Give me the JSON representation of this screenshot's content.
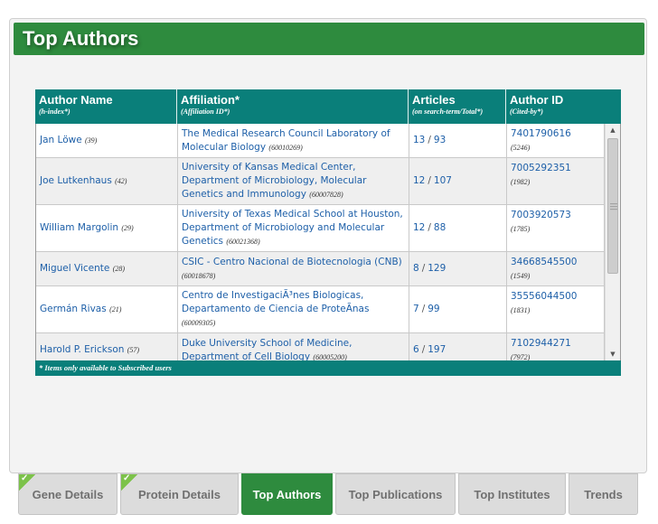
{
  "header": {
    "title": "Top Authors"
  },
  "table": {
    "columns": [
      {
        "label": "Author Name",
        "sub": "(h-index*)"
      },
      {
        "label": "Affiliation*",
        "sub": "(Affiliation ID*)"
      },
      {
        "label": "Articles",
        "sub": "(on search-term/Total*)"
      },
      {
        "label": "Author ID",
        "sub": "(Cited-by*)"
      }
    ],
    "sep": "/",
    "rows": [
      {
        "name": "Jan Löwe",
        "hindex": "(39)",
        "affiliation": "The Medical Research Council Laboratory of Molecular Biology",
        "aff_id": "(60010269)",
        "articles_term": "13",
        "articles_total": "93",
        "author_id": "7401790616",
        "cited": "(5246)"
      },
      {
        "name": "Joe Lutkenhaus",
        "hindex": "(42)",
        "affiliation": "University of Kansas Medical Center, Department of Microbiology, Molecular Genetics and Immunology",
        "aff_id": "(60007828)",
        "articles_term": "12",
        "articles_total": "107",
        "author_id": "7005292351",
        "cited": "(1982)"
      },
      {
        "name": "William Margolin",
        "hindex": "(29)",
        "affiliation": "University of Texas Medical School at Houston, Department of Microbiology and Molecular Genetics",
        "aff_id": "(60021368)",
        "articles_term": "12",
        "articles_total": "88",
        "author_id": "7003920573",
        "cited": "(1785)"
      },
      {
        "name": "Miguel Vicente",
        "hindex": "(28)",
        "affiliation": "CSIC - Centro Nacional de Biotecnologia (CNB)",
        "aff_id": "(60018678)",
        "articles_term": "8",
        "articles_total": "129",
        "author_id": "34668545500",
        "cited": "(1549)"
      },
      {
        "name": "Germán Rivas",
        "hindex": "(21)",
        "affiliation": "Centro de InvestigaciÃ³nes Biologicas, Departamento de Ciencia de ProteÃ­nas",
        "aff_id": "(60009305)",
        "articles_term": "7",
        "articles_total": "99",
        "author_id": "35556044500",
        "cited": "(1831)"
      },
      {
        "name": "Harold P. Erickson",
        "hindex": "(57)",
        "affiliation": "Duke University School of Medicine, Department of Cell Biology",
        "aff_id": "(60005200)",
        "articles_term": "6",
        "articles_total": "197",
        "author_id": "7102944271",
        "cited": "(7972)"
      }
    ],
    "footnote": "* Items only available to Subscribed users"
  },
  "tabs": [
    {
      "label": "Gene Details",
      "checked": true,
      "active": false
    },
    {
      "label": "Protein Details",
      "checked": true,
      "active": false
    },
    {
      "label": "Top Authors",
      "checked": false,
      "active": true
    },
    {
      "label": "Top Publications",
      "checked": false,
      "active": false
    },
    {
      "label": "Top Institutes",
      "checked": false,
      "active": false
    },
    {
      "label": "Trends",
      "checked": false,
      "active": false
    }
  ],
  "colors": {
    "header_green": "#2e8b3e",
    "table_teal": "#0a7f7a",
    "link_blue": "#1d5fa8",
    "check_green": "#7cc24a"
  },
  "icons": {
    "scroll_up": "scroll-up-arrow-icon",
    "scroll_down": "scroll-down-arrow-icon",
    "tab_check": "checkmark-icon"
  }
}
